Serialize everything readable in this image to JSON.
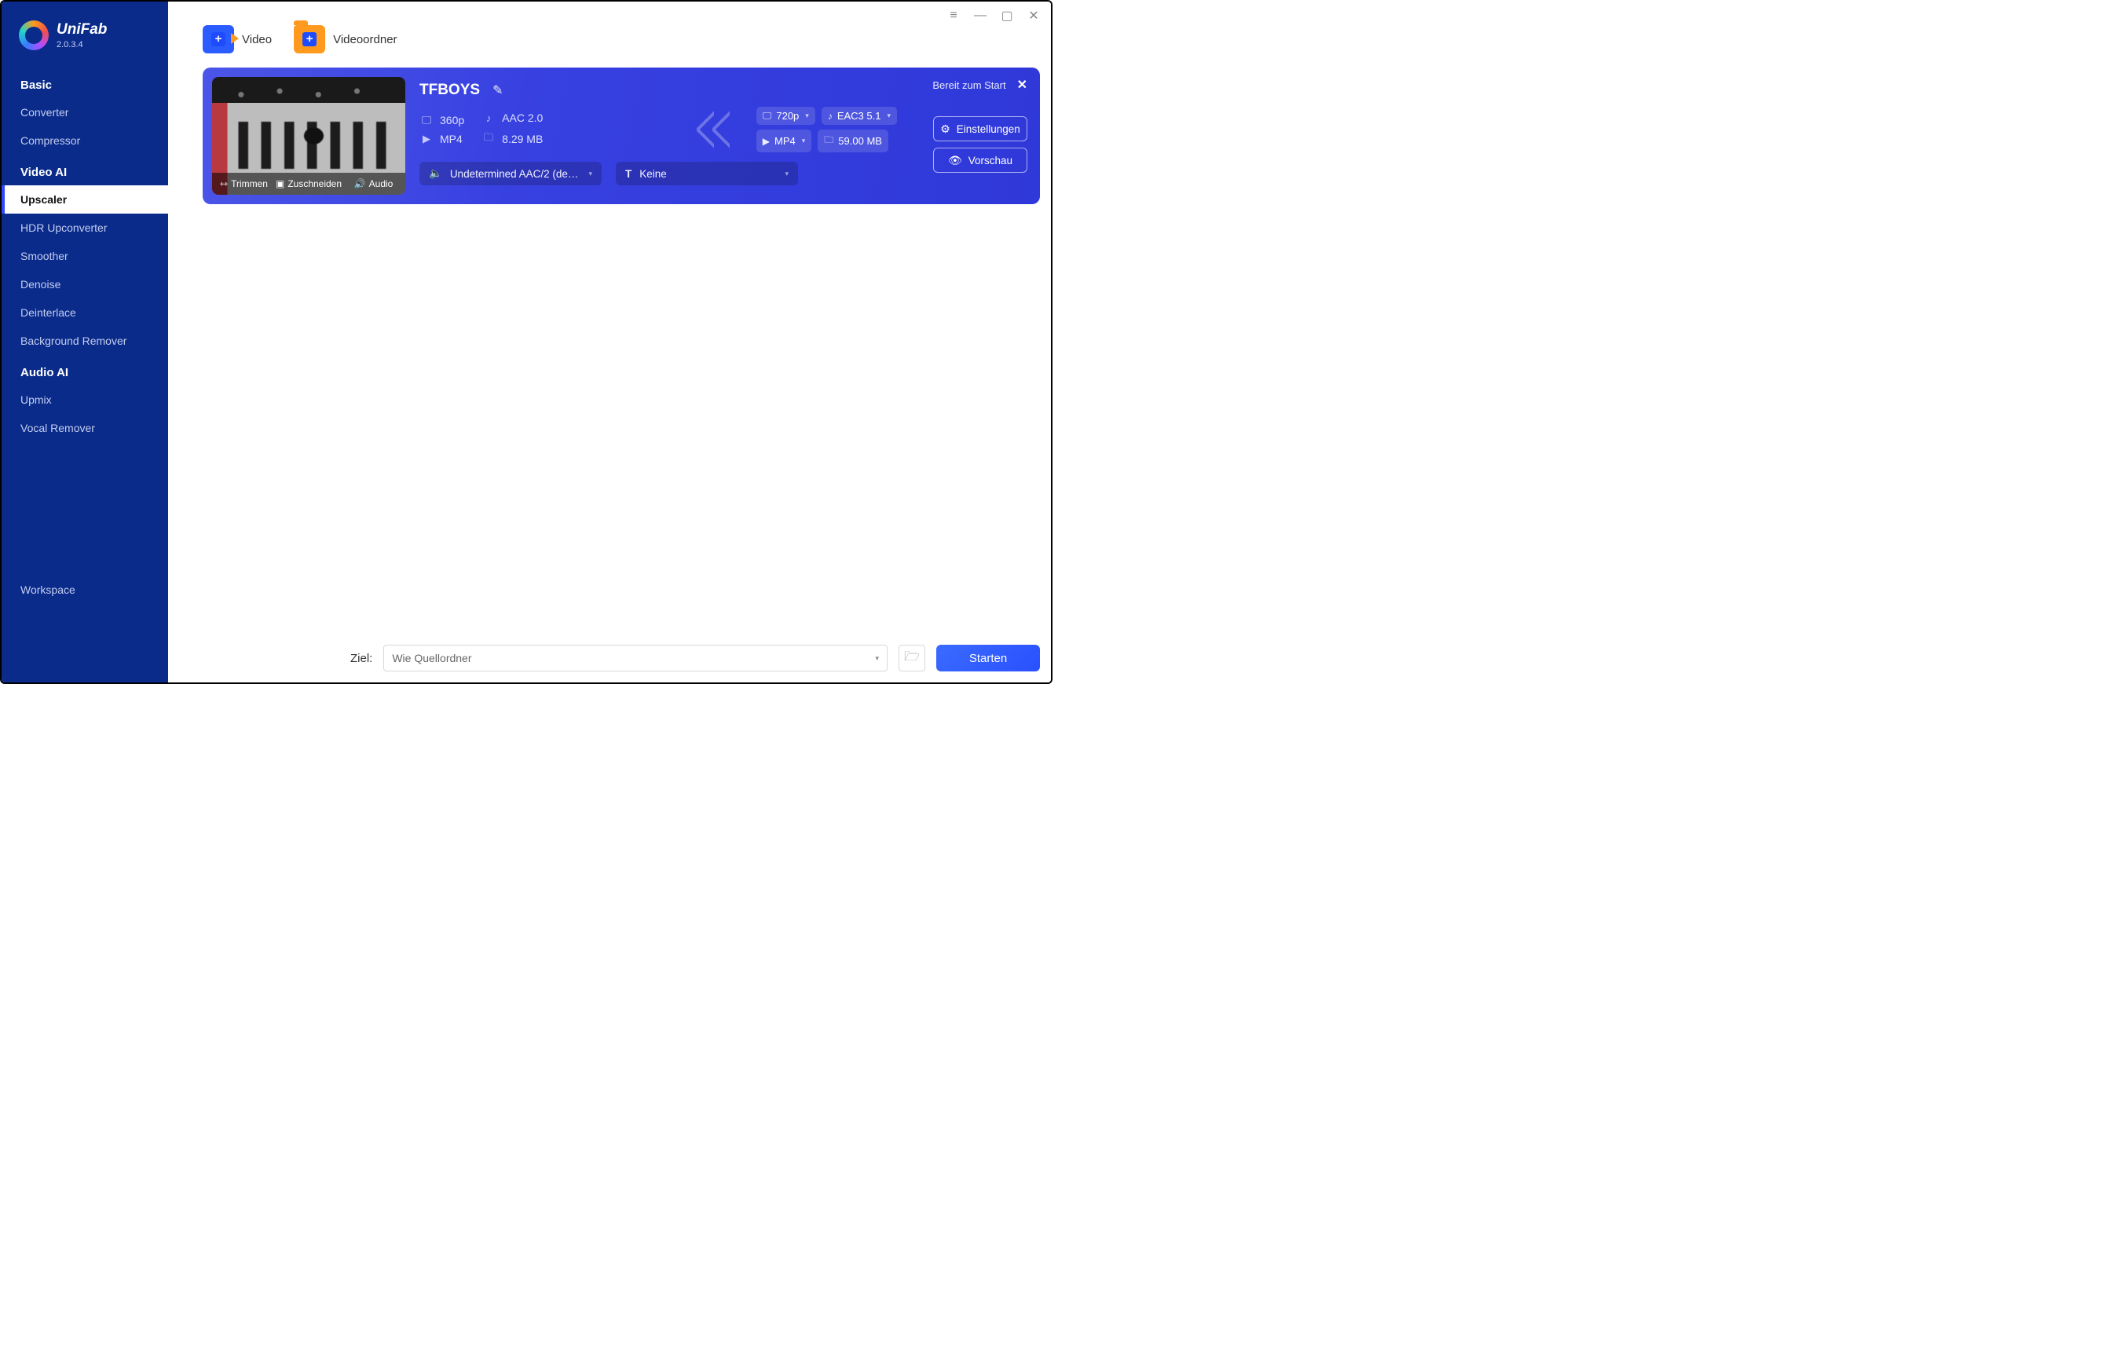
{
  "brand": {
    "name": "UniFab",
    "version": "2.0.3.4"
  },
  "sections": {
    "basic": {
      "title": "Basic",
      "items": [
        "Converter",
        "Compressor"
      ]
    },
    "videoai": {
      "title": "Video AI",
      "items": [
        "Upscaler",
        "HDR Upconverter",
        "Smoother",
        "Denoise",
        "Deinterlace",
        "Background Remover"
      ]
    },
    "audioai": {
      "title": "Audio AI",
      "items": [
        "Upmix",
        "Vocal Remover"
      ]
    },
    "workspace": {
      "items": [
        "Workspace"
      ]
    }
  },
  "active_nav": "Upscaler",
  "toolbar": {
    "video": "Video",
    "folder": "Videoordner"
  },
  "card": {
    "status": "Bereit zum Start",
    "title": "TFBOYS",
    "thumb_actions": {
      "trim": "Trimmen",
      "crop": "Zuschneiden",
      "audio": "Audio"
    },
    "src": {
      "res": "360p",
      "audio": "AAC 2.0",
      "container": "MP4",
      "size": "8.29 MB"
    },
    "dst": {
      "res": "720p",
      "audio": "EAC3 5.1",
      "container": "MP4",
      "size": "59.00 MB"
    },
    "audio_track": "Undetermined AAC/2 (default)",
    "subtitle": "Keine",
    "buttons": {
      "settings": "Einstellungen",
      "preview": "Vorschau"
    }
  },
  "footer": {
    "label": "Ziel:",
    "value": "Wie Quellordner",
    "start": "Starten"
  }
}
